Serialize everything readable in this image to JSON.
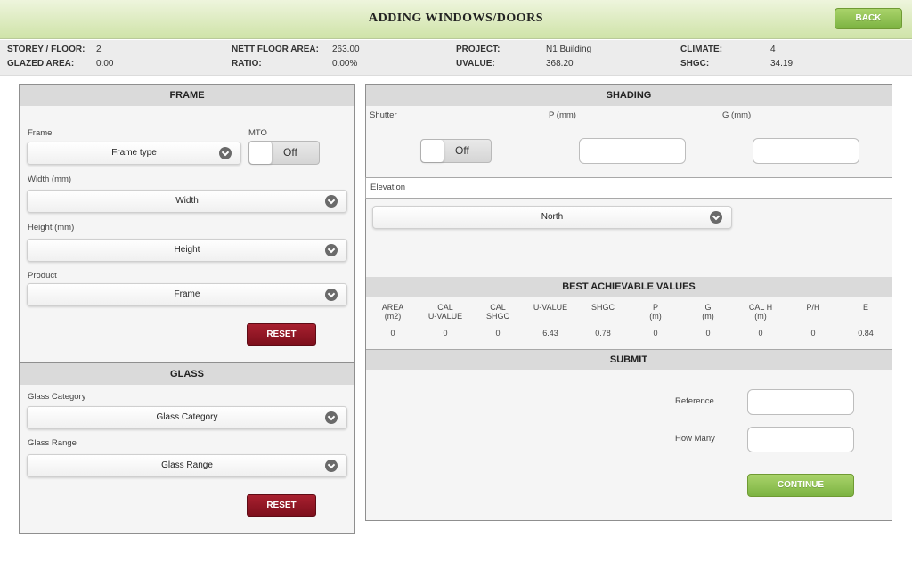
{
  "header": {
    "title": "ADDING WINDOWS/DOORS",
    "back_label": "BACK"
  },
  "info": {
    "storey_label": "STOREY / FLOOR:",
    "storey_value": "2",
    "glazed_label": "GLAZED AREA:",
    "glazed_value": "0.00",
    "nett_label": "NETT FLOOR AREA:",
    "nett_value": "263.00",
    "ratio_label": "RATIO:",
    "ratio_value": "0.00%",
    "project_label": "PROJECT:",
    "project_value": "N1 Building",
    "uvalue_label": "UVALUE:",
    "uvalue_value": "368.20",
    "climate_label": "CLIMATE:",
    "climate_value": "4",
    "shgc_label": "SHGC:",
    "shgc_value": "34.19"
  },
  "frame": {
    "heading": "FRAME",
    "frame_label": "Frame",
    "frame_value": "Frame type",
    "mto_label": "MTO",
    "mto_state": "Off",
    "width_label": "Width (mm)",
    "width_value": "Width",
    "height_label": "Height (mm)",
    "height_value": "Height",
    "product_label": "Product",
    "product_value": "Frame",
    "reset_label": "RESET"
  },
  "glass": {
    "heading": "GLASS",
    "category_label": "Glass Category",
    "category_value": "Glass Category",
    "range_label": "Glass Range",
    "range_value": "Glass Range",
    "reset_label": "RESET"
  },
  "shading": {
    "heading": "SHADING",
    "shutter_label": "Shutter",
    "shutter_state": "Off",
    "p_label": "P (mm)",
    "g_label": "G (mm)",
    "elevation_label": "Elevation",
    "elevation_value": "North"
  },
  "best_values": {
    "heading": "BEST ACHIEVABLE VALUES",
    "columns": [
      {
        "header": "AREA\n(m2)",
        "value": "0"
      },
      {
        "header": "CAL\nU-VALUE",
        "value": "0"
      },
      {
        "header": "CAL\nSHGC",
        "value": "0"
      },
      {
        "header": "U-VALUE",
        "value": "6.43"
      },
      {
        "header": "SHGC",
        "value": "0.78"
      },
      {
        "header": "P\n(m)",
        "value": "0"
      },
      {
        "header": "G\n(m)",
        "value": "0"
      },
      {
        "header": "CAL H\n(m)",
        "value": "0"
      },
      {
        "header": "P/H",
        "value": "0"
      },
      {
        "header": "E",
        "value": "0.84"
      }
    ]
  },
  "submit": {
    "heading": "SUBMIT",
    "reference_label": "Reference",
    "how_many_label": "How Many",
    "continue_label": "CONTINUE"
  }
}
